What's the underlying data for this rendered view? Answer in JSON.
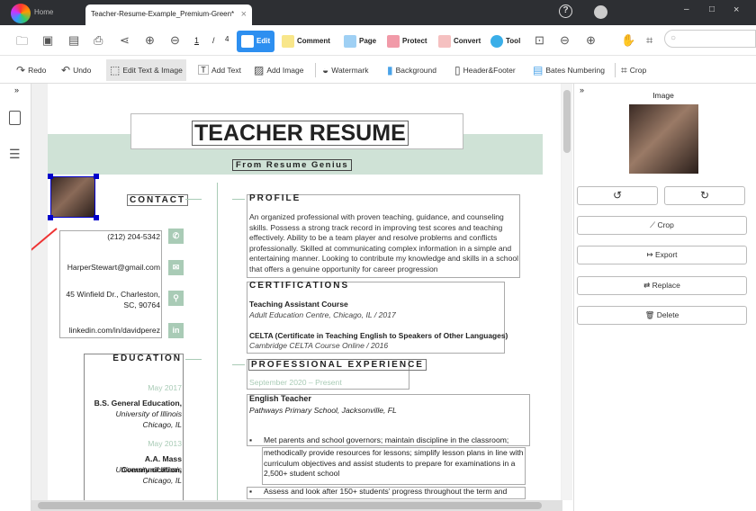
{
  "titlebar": {
    "home_tab": "Home",
    "doc_tab": "Teacher-Resume-Example_Premium-Green*",
    "close": "×",
    "help": "?",
    "minimize": "–",
    "maximize": "□",
    "close_window": "×"
  },
  "toolbar": {
    "page_current": "1",
    "page_sep": "/",
    "page_total": "4",
    "modes": [
      "Edit",
      "Comment",
      "Page",
      "Protect",
      "Convert",
      "Tool"
    ],
    "search_placeholder": ""
  },
  "edit_toolbar": {
    "redo": "Redo",
    "undo": "Undo",
    "edit_text_image": "Edit Text & Image",
    "add_text": "Add Text",
    "add_image": "Add Image",
    "watermark": "Watermark",
    "background": "Background",
    "header_footer": "Header&Footer",
    "bates": "Bates Numbering",
    "crop": "Crop"
  },
  "colors": {
    "accent": "#2d8ff0",
    "resume_green": "#a9cbb6"
  },
  "right_panel": {
    "expand": "»",
    "title": "Image",
    "crop": "Crop",
    "export": "Export",
    "replace": "Replace",
    "delete": "Delete"
  },
  "left_panel": {
    "expand": "»"
  },
  "resume": {
    "title": "TEACHER RESUME",
    "subtitle": "From Resume Genius",
    "contact_heading": "CONTACT",
    "phone": "(212) 204-5342",
    "email": "HarperStewart@gmail.com",
    "address1": "45 Winfield Dr., Charleston,",
    "address2": "SC, 90764",
    "linkedin": "linkedin.com/in/davidperez",
    "education_heading": "EDUCATION",
    "education": [
      {
        "date": "May 2017",
        "degree": "B.S. General Education,",
        "school": "University of Illinois",
        "city": "Chicago, IL"
      },
      {
        "date": "May 2013",
        "degree": "A.A. Mass Communication,",
        "school": "University of Illinois",
        "city": "Chicago, IL"
      }
    ],
    "profile_heading": "PROFILE",
    "profile_text": "An organized professional with proven teaching, guidance, and counseling skills. Possess a strong track record in improving test scores and teaching effectively. Ability to be a team player and resolve problems and conflicts professionally. Skilled at communicating complex information in a simple and entertaining manner. Looking to contribute my knowledge and skills in a school that offers a genuine opportunity for career progression",
    "cert_heading": "CERTIFICATIONS",
    "certs": [
      {
        "name": "Teaching Assistant Course",
        "detail": "Adult Education Centre, Chicago, IL / 2017"
      },
      {
        "name": "CELTA (Certificate in Teaching English to Speakers of Other Languages)",
        "detail": "Cambridge CELTA Course Online / 2016"
      }
    ],
    "exp_heading": "PROFESSIONAL EXPERIENCE",
    "exp_date": "September 2020 – Present",
    "job_title": "English Teacher",
    "job_place": "Pathways Primary School, Jacksonville, FL",
    "bullet1a": "Met parents and school governors; maintain discipline in the classroom;",
    "bullet1b": "methodically provide resources for lessons; simplify lesson plans in line with curriculum objectives and assist students to prepare for examinations in a 2,500+ student school",
    "bullet2": "Assess and look after 150+ students’ progress throughout the term and"
  }
}
